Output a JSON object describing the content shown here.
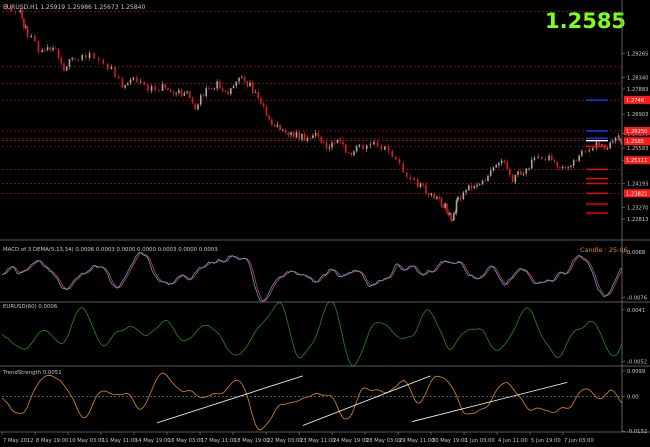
{
  "window": {
    "symbol_line": "EURUSD,H1  1.25919 1.25986 1.25673 1.25840",
    "big_price": "1.2585"
  },
  "colors": {
    "background": "#000000",
    "grid": "#3a3a3a",
    "bull_candle": "#a8a8a8",
    "bear_candle": "#d81e1e",
    "level_line": "#c41616",
    "big_price": "#7cff1c",
    "panel_text": "#c8c8c8",
    "macd_main": "#5aa0d8",
    "macd_signal": "#d84040",
    "eur_line": "#1e8c1e",
    "trend_line": "#e38a12",
    "trend_tangents": "#ffffff",
    "candle_timer": "#e38a12",
    "price_tag_bg": "#ff1a1a",
    "marker_red": "#ff0000",
    "marker_blue": "#1e3cff",
    "marker_white": "#ffffff"
  },
  "chart_data": [
    {
      "type": "candlestick",
      "title": "EURUSD,H1",
      "ylim": [
        1.22,
        1.312
      ],
      "y_ticks": [
        "1.29265",
        "1.28340",
        "1.27883",
        "1.26903",
        "1.26158",
        "1.25583",
        "1.25111",
        "1.24193",
        "1.23270",
        "1.22813"
      ],
      "price_tags": [
        "1.2746",
        "1.26250",
        "1.2585",
        "1.25111",
        "1.23821"
      ],
      "resistance_levels": [
        1.309,
        1.2875,
        1.281,
        1.2745,
        1.2625,
        1.2597,
        1.2587,
        1.2565,
        1.2475,
        1.242,
        1.2382
      ],
      "right_markers": [
        {
          "price": 1.2745,
          "color": "blue"
        },
        {
          "price": 1.2625,
          "color": "blue"
        },
        {
          "price": 1.2597,
          "color": "blue"
        },
        {
          "price": 1.2587,
          "color": "white"
        },
        {
          "price": 1.2565,
          "color": "red"
        },
        {
          "price": 1.2475,
          "color": "red"
        },
        {
          "price": 1.244,
          "color": "red"
        },
        {
          "price": 1.242,
          "color": "red"
        },
        {
          "price": 1.2382,
          "color": "red"
        },
        {
          "price": 1.234,
          "color": "red"
        },
        {
          "price": 1.2305,
          "color": "red"
        }
      ],
      "path": [
        [
          0,
          1.312
        ],
        [
          10,
          1.308
        ],
        [
          14,
          1.3
        ],
        [
          22,
          1.293
        ],
        [
          28,
          1.296
        ],
        [
          34,
          1.287
        ],
        [
          40,
          1.291
        ],
        [
          48,
          1.292
        ],
        [
          58,
          1.288
        ],
        [
          66,
          1.28
        ],
        [
          72,
          1.283
        ],
        [
          80,
          1.278
        ],
        [
          88,
          1.28
        ],
        [
          94,
          1.276
        ],
        [
          100,
          1.278
        ],
        [
          106,
          1.272
        ],
        [
          112,
          1.278
        ],
        [
          118,
          1.281
        ],
        [
          124,
          1.276
        ],
        [
          130,
          1.284
        ],
        [
          136,
          1.28
        ],
        [
          142,
          1.273
        ],
        [
          148,
          1.266
        ],
        [
          154,
          1.262
        ],
        [
          160,
          1.261
        ],
        [
          166,
          1.26
        ],
        [
          172,
          1.262
        ],
        [
          178,
          1.256
        ],
        [
          184,
          1.259
        ],
        [
          190,
          1.254
        ],
        [
          196,
          1.256
        ],
        [
          204,
          1.258
        ],
        [
          212,
          1.254
        ],
        [
          220,
          1.247
        ],
        [
          228,
          1.242
        ],
        [
          234,
          1.238
        ],
        [
          240,
          1.235
        ],
        [
          244,
          1.232
        ],
        [
          247,
          1.228
        ],
        [
          250,
          1.236
        ],
        [
          256,
          1.24
        ],
        [
          262,
          1.241
        ],
        [
          268,
          1.247
        ],
        [
          274,
          1.252
        ],
        [
          280,
          1.244
        ],
        [
          286,
          1.247
        ],
        [
          292,
          1.251
        ],
        [
          300,
          1.252
        ],
        [
          306,
          1.247
        ],
        [
          312,
          1.25
        ],
        [
          318,
          1.254
        ],
        [
          326,
          1.257
        ],
        [
          332,
          1.256
        ],
        [
          338,
          1.2598
        ],
        [
          340,
          1.2585
        ]
      ],
      "candles_per_step": 4
    },
    {
      "type": "line",
      "title": "MACD of 3 DEMA(5,13,34) 0.0006 0.0003 0.0000 0.0000 0.0003 0.0000 0.0003",
      "ylim": [
        -0.009,
        0.009
      ],
      "y_ticks": [
        "0.0068",
        "-0.0076"
      ],
      "annotation": "Candle : 25:06",
      "series": [
        {
          "name": "",
          "seed": 7
        },
        {
          "name": "",
          "seed": 7,
          "lag": 2
        }
      ]
    },
    {
      "type": "line",
      "title": "EURUSD(60)  0.0006",
      "ylim": [
        -0.006,
        0.0055
      ],
      "y_ticks": [
        "0.0041",
        "-0.0052"
      ],
      "series": [
        {
          "name": "",
          "seed": 19
        }
      ]
    },
    {
      "type": "line",
      "title": "TrendStrength 0.0051",
      "ylim": [
        -0.0135,
        0.011
      ],
      "y_ticks": [
        "0.0099",
        "0.00",
        "-0.0132"
      ],
      "zero_level": 0.0,
      "series": [
        {
          "name": "",
          "seed": 31
        }
      ],
      "tangent_lines": [
        [
          [
            85,
            -0.01
          ],
          [
            165,
            0.008
          ]
        ],
        [
          [
            165,
            -0.011
          ],
          [
            235,
            0.008
          ]
        ],
        [
          [
            225,
            -0.0095
          ],
          [
            310,
            0.0055
          ]
        ]
      ]
    }
  ],
  "x_axis": {
    "labels": [
      "7 May 2012",
      "8 May 19:00",
      "10 May 03:00",
      "11 May 11:00",
      "14 May 19:00",
      "16 May 03:00",
      "17 May 11:00",
      "18 May 19:00",
      "22 May 03:00",
      "23 May 11:00",
      "24 May 19:00",
      "28 May 03:00",
      "29 May 11:00",
      "30 May 19:00",
      "1 Jun 03:00",
      "4 Jun 11:00",
      "5 Jun 19:00",
      "7 Jun 03:00"
    ]
  }
}
